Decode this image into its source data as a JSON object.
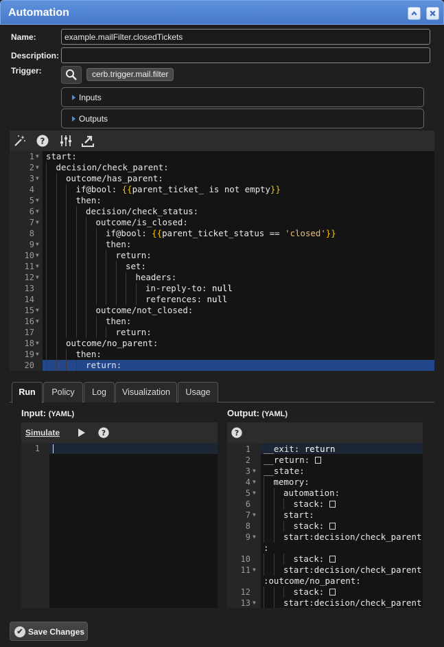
{
  "window": {
    "title": "Automation"
  },
  "form": {
    "name_label": "Name:",
    "name_value": "example.mailFilter.closedTickets",
    "description_label": "Description:",
    "description_value": "",
    "trigger_label": "Trigger:",
    "trigger_value": "cerb.trigger.mail.filter",
    "inputs_label": "Inputs",
    "outputs_label": "Outputs"
  },
  "editor": {
    "toolbar_icons": [
      "magic-wand-icon",
      "help-icon",
      "sliders-icon",
      "export-icon"
    ],
    "lines": [
      {
        "n": "1",
        "fold": true,
        "indent": 0,
        "parts": [
          [
            "k",
            "start:"
          ]
        ]
      },
      {
        "n": "2",
        "fold": true,
        "indent": 1,
        "parts": [
          [
            "k",
            "decision/check_parent:"
          ]
        ]
      },
      {
        "n": "3",
        "fold": true,
        "indent": 2,
        "parts": [
          [
            "k",
            "outcome/has_parent:"
          ]
        ]
      },
      {
        "n": "4",
        "fold": false,
        "indent": 3,
        "parts": [
          [
            "k",
            "if@bool: "
          ],
          [
            "br",
            "{{"
          ],
          [
            "k",
            "parent_ticket_ is not empty"
          ],
          [
            "br",
            "}}"
          ]
        ]
      },
      {
        "n": "5",
        "fold": true,
        "indent": 3,
        "parts": [
          [
            "k",
            "then:"
          ]
        ]
      },
      {
        "n": "6",
        "fold": true,
        "indent": 4,
        "parts": [
          [
            "k",
            "decision/check_status:"
          ]
        ]
      },
      {
        "n": "7",
        "fold": true,
        "indent": 5,
        "parts": [
          [
            "k",
            "outcome/is_closed:"
          ]
        ]
      },
      {
        "n": "8",
        "fold": false,
        "indent": 6,
        "parts": [
          [
            "k",
            "if@bool: "
          ],
          [
            "br",
            "{{"
          ],
          [
            "k",
            "parent_ticket_status == "
          ],
          [
            "str",
            "'closed'"
          ],
          [
            "br",
            "}}"
          ]
        ]
      },
      {
        "n": "9",
        "fold": true,
        "indent": 6,
        "parts": [
          [
            "k",
            "then:"
          ]
        ]
      },
      {
        "n": "10",
        "fold": true,
        "indent": 7,
        "parts": [
          [
            "k",
            "return:"
          ]
        ]
      },
      {
        "n": "11",
        "fold": true,
        "indent": 8,
        "parts": [
          [
            "k",
            "set:"
          ]
        ]
      },
      {
        "n": "12",
        "fold": true,
        "indent": 9,
        "parts": [
          [
            "k",
            "headers:"
          ]
        ]
      },
      {
        "n": "13",
        "fold": false,
        "indent": 10,
        "parts": [
          [
            "k",
            "in-reply-to: "
          ],
          [
            "kw",
            "null"
          ]
        ]
      },
      {
        "n": "14",
        "fold": false,
        "indent": 10,
        "parts": [
          [
            "k",
            "references: "
          ],
          [
            "kw",
            "null"
          ]
        ]
      },
      {
        "n": "15",
        "fold": true,
        "indent": 5,
        "parts": [
          [
            "k",
            "outcome/not_closed:"
          ]
        ]
      },
      {
        "n": "16",
        "fold": true,
        "indent": 6,
        "parts": [
          [
            "k",
            "then:"
          ]
        ]
      },
      {
        "n": "17",
        "fold": false,
        "indent": 7,
        "parts": [
          [
            "k",
            "return:"
          ]
        ]
      },
      {
        "n": "18",
        "fold": true,
        "indent": 2,
        "parts": [
          [
            "k",
            "outcome/no_parent:"
          ]
        ]
      },
      {
        "n": "19",
        "fold": true,
        "indent": 3,
        "parts": [
          [
            "k",
            "then:"
          ]
        ]
      },
      {
        "n": "20",
        "fold": false,
        "indent": 4,
        "parts": [
          [
            "k",
            "return:"
          ]
        ]
      }
    ]
  },
  "tabs": [
    {
      "label": "Run",
      "active": true
    },
    {
      "label": "Policy",
      "active": false
    },
    {
      "label": "Log",
      "active": false
    },
    {
      "label": "Visualization",
      "active": false
    },
    {
      "label": "Usage",
      "active": false
    }
  ],
  "run": {
    "input_title": "Input:",
    "input_format": "(YAML)",
    "simulate_label": "Simulate",
    "output_title": "Output:",
    "output_format": "(YAML)",
    "input_lines": [
      "1"
    ],
    "output_lines": [
      {
        "n": "1",
        "fold": false,
        "indent": 0,
        "text": "__exit: ",
        "val": "return",
        "box": false
      },
      {
        "n": "2",
        "fold": false,
        "indent": 0,
        "text": "__return: ",
        "val": "",
        "box": true
      },
      {
        "n": "3",
        "fold": true,
        "indent": 0,
        "text": "__state:",
        "val": "",
        "box": false
      },
      {
        "n": "4",
        "fold": true,
        "indent": 1,
        "text": "memory:",
        "val": "",
        "box": false
      },
      {
        "n": "5",
        "fold": true,
        "indent": 2,
        "text": "automation:",
        "val": "",
        "box": false
      },
      {
        "n": "6",
        "fold": false,
        "indent": 3,
        "text": "stack: ",
        "val": "",
        "box": true
      },
      {
        "n": "7",
        "fold": true,
        "indent": 2,
        "text": "start:",
        "val": "",
        "box": false
      },
      {
        "n": "8",
        "fold": false,
        "indent": 3,
        "text": "stack: ",
        "val": "",
        "box": true
      },
      {
        "n": "9",
        "fold": true,
        "indent": 2,
        "text": "start:decision/check_parent",
        "val": "",
        "box": false,
        "wrap": ":"
      },
      {
        "n": "10",
        "fold": false,
        "indent": 3,
        "text": "stack: ",
        "val": "",
        "box": true
      },
      {
        "n": "11",
        "fold": true,
        "indent": 2,
        "text": "start:decision/check_parent",
        "val": "",
        "box": false,
        "wrap": ":outcome/no_parent:"
      },
      {
        "n": "12",
        "fold": false,
        "indent": 3,
        "text": "stack: ",
        "val": "",
        "box": true
      },
      {
        "n": "13",
        "fold": true,
        "indent": 2,
        "text": "start:decision/check_parent",
        "val": "",
        "box": false
      }
    ]
  },
  "footer": {
    "save_label": "Save Changes"
  }
}
